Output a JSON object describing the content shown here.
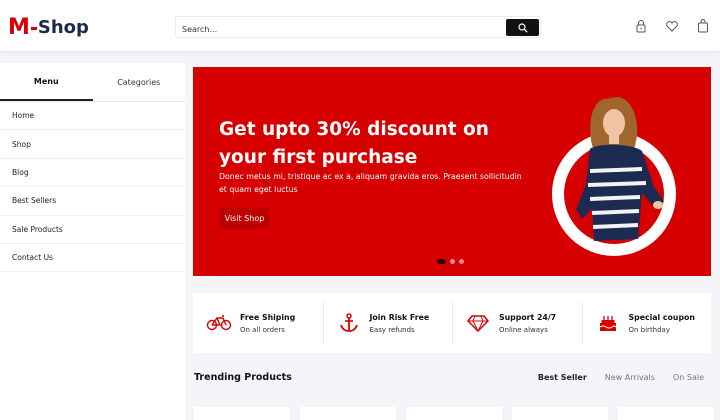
{
  "header": {
    "logo_m": "M",
    "logo_shop": "Shop",
    "search_placeholder": "Search..."
  },
  "sidebar": {
    "tabs": [
      {
        "label": "Menu",
        "active": true
      },
      {
        "label": "Categories",
        "active": false
      }
    ],
    "items": [
      {
        "label": "Home"
      },
      {
        "label": "Shop"
      },
      {
        "label": "Blog"
      },
      {
        "label": "Best Sellers"
      },
      {
        "label": "Sale Products"
      },
      {
        "label": "Contact Us"
      }
    ]
  },
  "banner": {
    "title": "Get upto 30% discount on your first purchase",
    "subtitle": "Donec metus mi, tristique ac ex a, aliquam gravida eros. Praesent sollicitudin et quam eget luctus",
    "button": "Visit Shop",
    "slides": 3,
    "active_slide": 1
  },
  "features": [
    {
      "icon": "bicycle-icon",
      "title": "Free Shiping",
      "subtitle": "On all orders"
    },
    {
      "icon": "anchor-icon",
      "title": "Join Risk Free",
      "subtitle": "Easy refunds"
    },
    {
      "icon": "diamond-icon",
      "title": "Support 24/7",
      "subtitle": "Online always"
    },
    {
      "icon": "cake-icon",
      "title": "Special coupon",
      "subtitle": "On birthday"
    }
  ],
  "trending": {
    "title": "Trending Products",
    "tabs": [
      {
        "label": "Best Seller",
        "active": true
      },
      {
        "label": "New Arrivals",
        "active": false
      },
      {
        "label": "On Sale",
        "active": false
      }
    ]
  },
  "colors": {
    "brand_red": "#d70000",
    "brand_navy": "#1b2a4a"
  }
}
